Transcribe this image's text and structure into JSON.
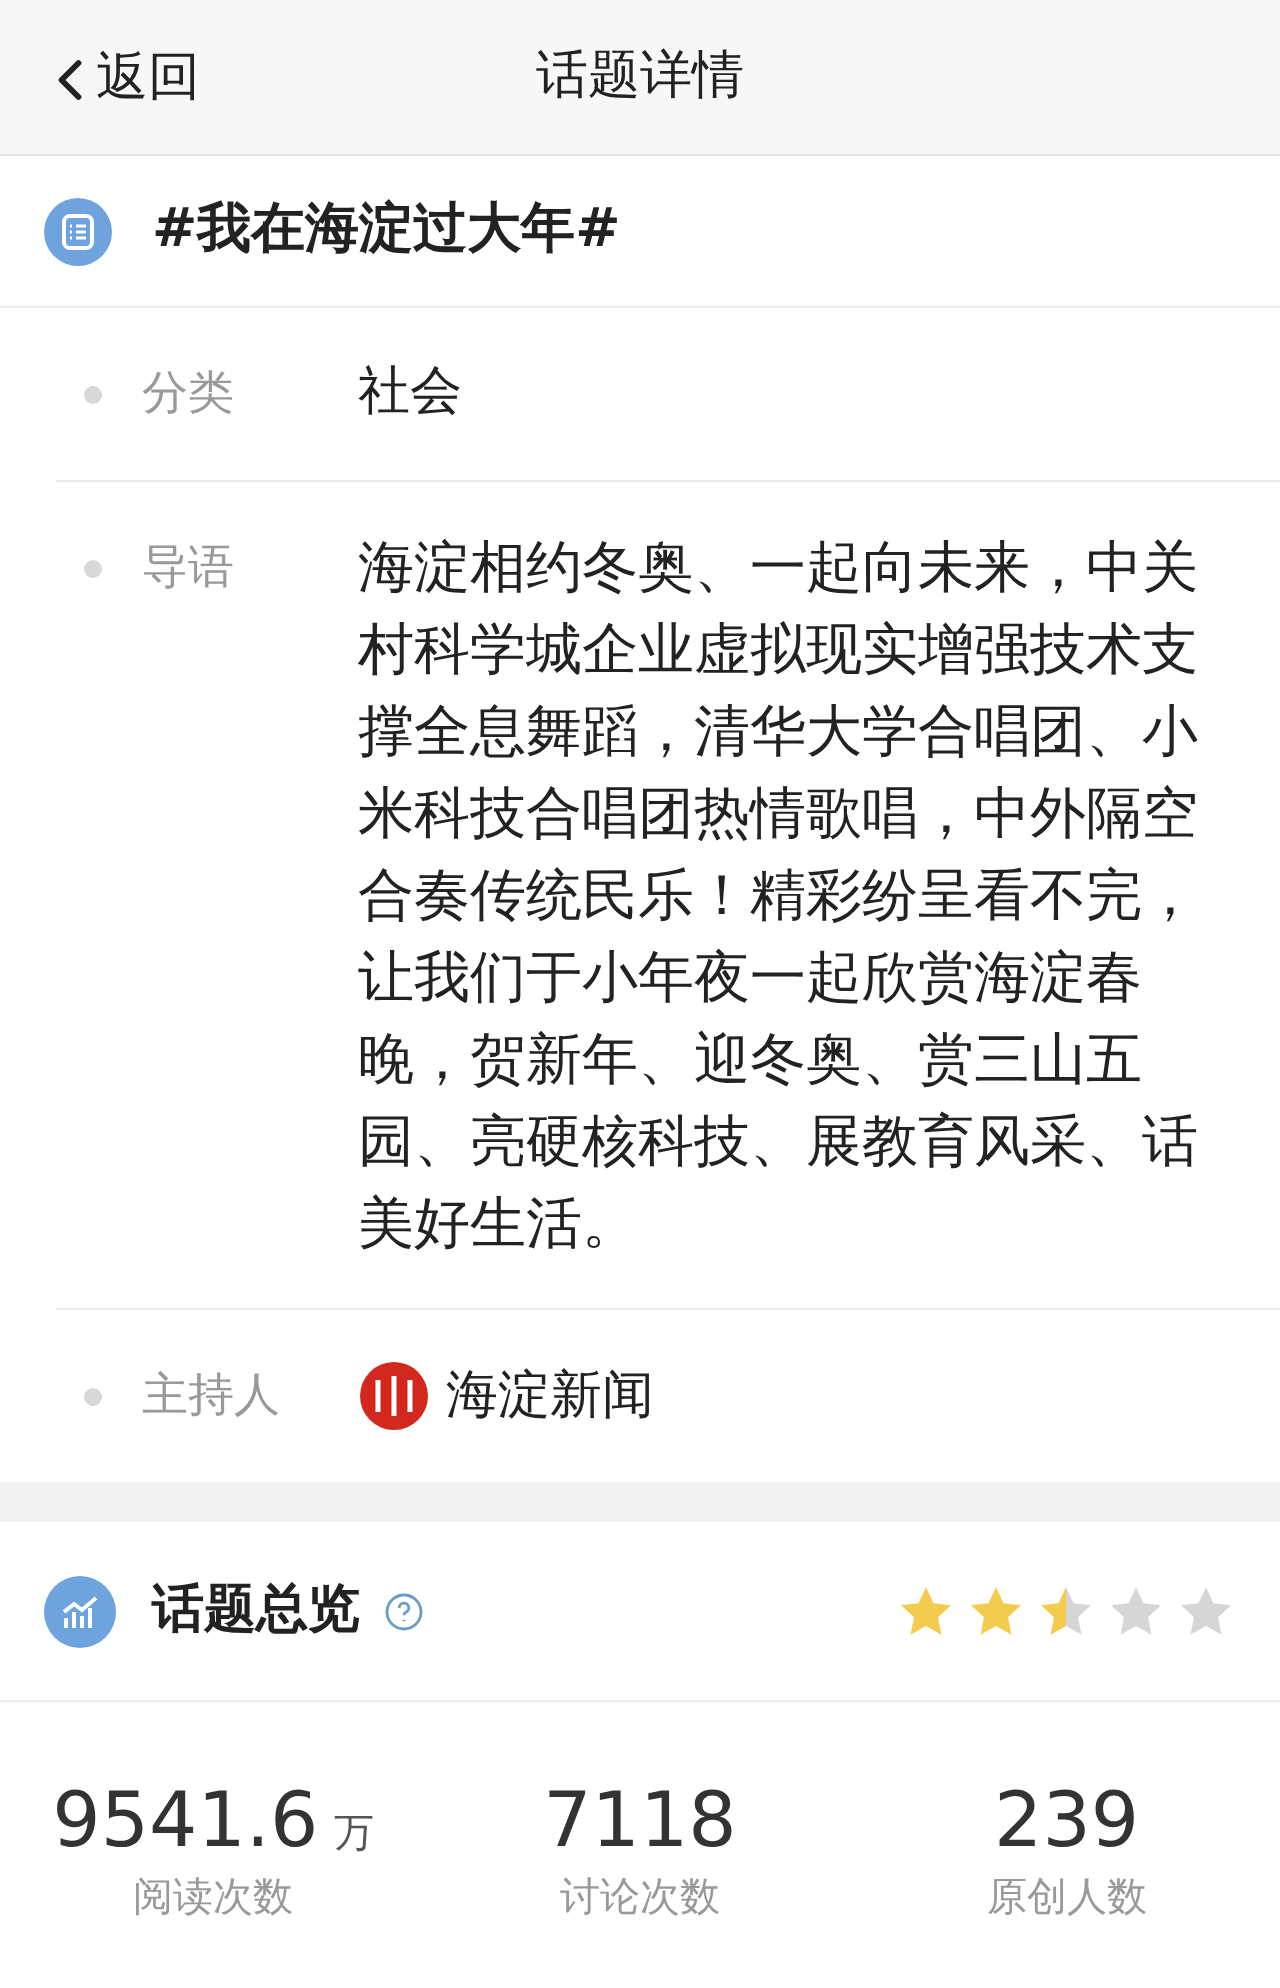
{
  "nav": {
    "back": "返回",
    "title": "话题详情"
  },
  "topic": {
    "title": "#我在海淀过大年#"
  },
  "details": [
    {
      "kind": "text",
      "label": "分类",
      "value": "社会"
    },
    {
      "kind": "text",
      "label": "导语",
      "value": "海淀相约冬奥、一起向未来，中关村科学城企业虚拟现实增强技术支撑全息舞蹈，清华大学合唱团、小米科技合唱团热情歌唱，中外隔空合奏传统民乐！精彩纷呈看不完，让我们于小年夜一起欣赏海淀春晚，贺新年、迎冬奥、赏三山五园、亮硬核科技、展教育风采、话美好生活。"
    },
    {
      "kind": "host",
      "label": "主持人",
      "value": "海淀新闻"
    }
  ],
  "overview": {
    "title": "话题总览",
    "stars": 2.5,
    "stats": [
      {
        "value": "9541.6",
        "unit": "万",
        "label": "阅读次数"
      },
      {
        "value": "7118",
        "label": "讨论次数"
      },
      {
        "value": "239",
        "label": "原创人数"
      }
    ]
  }
}
